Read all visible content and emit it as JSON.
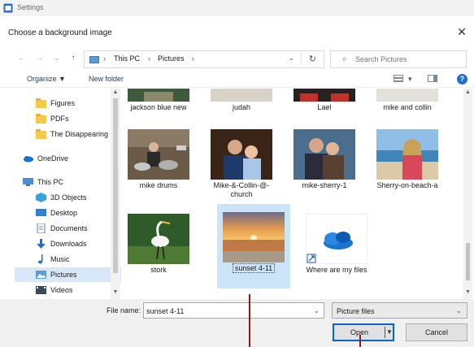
{
  "window": {
    "app_title": "Settings"
  },
  "dialog": {
    "title": "Choose a background image"
  },
  "address": {
    "path": [
      "This PC",
      "Pictures"
    ],
    "search_placeholder": "Search Pictures"
  },
  "toolbar": {
    "organize": "Organize ▼",
    "new_folder": "New folder"
  },
  "nav": [
    {
      "label": "Figures",
      "icon": "folder-icon"
    },
    {
      "label": "PDFs",
      "icon": "folder-icon"
    },
    {
      "label": "The Disappearing",
      "icon": "folder-icon"
    },
    {
      "label": "OneDrive",
      "icon": "onedrive-icon"
    },
    {
      "label": "This PC",
      "icon": "this-pc-icon"
    },
    {
      "label": "3D Objects",
      "icon": "3d-objects-icon"
    },
    {
      "label": "Desktop",
      "icon": "desktop-icon"
    },
    {
      "label": "Documents",
      "icon": "documents-icon"
    },
    {
      "label": "Downloads",
      "icon": "downloads-icon"
    },
    {
      "label": "Music",
      "icon": "music-icon"
    },
    {
      "label": "Pictures",
      "icon": "pictures-icon"
    },
    {
      "label": "Videos",
      "icon": "videos-icon"
    }
  ],
  "files": [
    {
      "label": "jackson blue new"
    },
    {
      "label": "judah"
    },
    {
      "label": "Lael"
    },
    {
      "label": "mike and collin"
    },
    {
      "label": "mike drums"
    },
    {
      "label": "Mike-&-Collin-@-church"
    },
    {
      "label": "mike-sherry-1"
    },
    {
      "label": "Sherry-on-beach-a"
    },
    {
      "label": "stork"
    },
    {
      "label": "sunset 4-11"
    },
    {
      "label": "Where are my files"
    }
  ],
  "footer": {
    "file_name_label": "File name:",
    "file_name_value": "sunset 4-11",
    "filter": "Picture files",
    "open": "Open",
    "cancel": "Cancel"
  },
  "colors": {
    "accent": "#0a63c9",
    "selection": "#cce4f7",
    "callout": "#8b1a1a"
  }
}
